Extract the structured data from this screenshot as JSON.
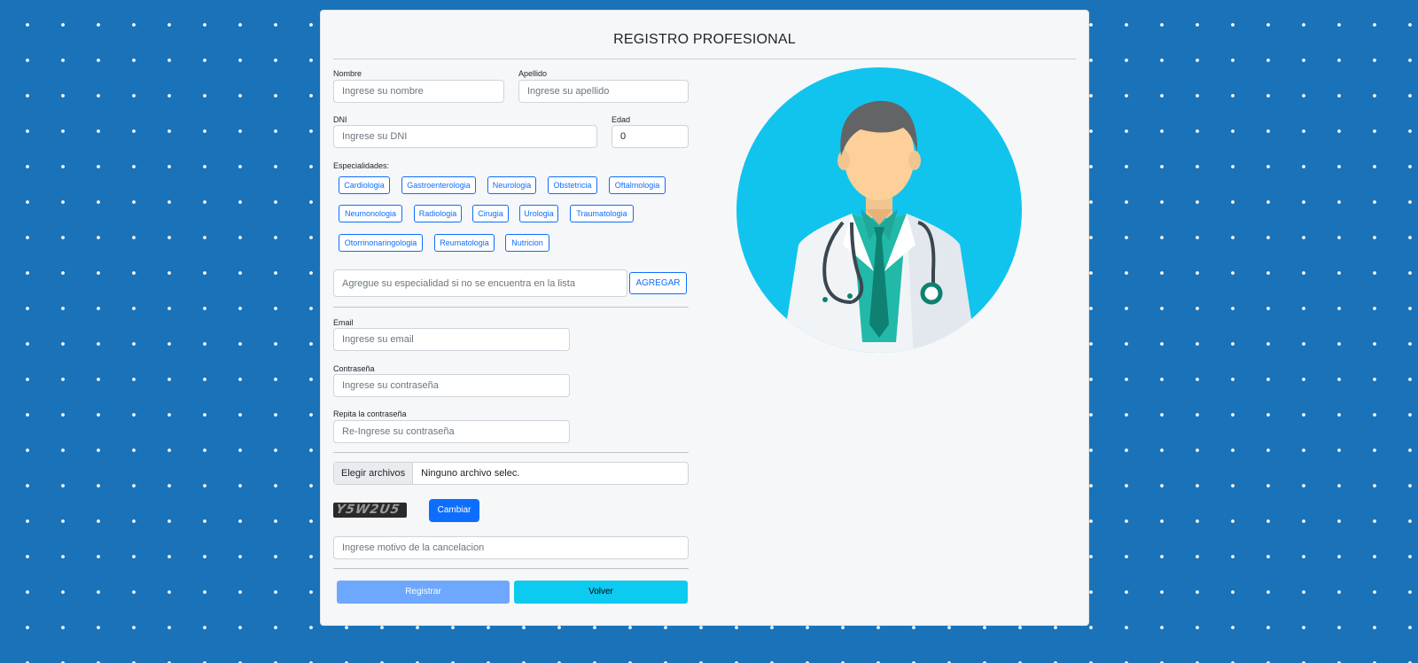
{
  "form": {
    "title": "REGISTRO PROFESIONAL",
    "nombre": {
      "label": "Nombre",
      "placeholder": "Ingrese su nombre"
    },
    "apellido": {
      "label": "Apellido",
      "placeholder": "Ingrese su apellido"
    },
    "dni": {
      "label": "DNI",
      "placeholder": "Ingrese su DNI"
    },
    "edad": {
      "label": "Edad",
      "value": "0"
    },
    "especialidades": {
      "label": "Especialidades:",
      "items": [
        "Cardiologia",
        "Gastroenterologia",
        "Neurologia",
        "Obstetricia",
        "Oftalmologia",
        "Neumonologia",
        "Radiologia",
        "Cirugia",
        "Urologia",
        "Traumatologia",
        "Otorrinonaringologia",
        "Reumatologia",
        "Nutricion"
      ],
      "add_placeholder": "Agregue su especialidad si no se encuentra en la lista",
      "add_button": "AGREGAR"
    },
    "email": {
      "label": "Email",
      "placeholder": "Ingrese su email"
    },
    "password": {
      "label": "Contraseña",
      "placeholder": "Ingrese su contraseña"
    },
    "password_repeat": {
      "label": "Repita la contraseña",
      "placeholder": "Re-Ingrese su contraseña"
    },
    "file": {
      "button": "Elegir archivos",
      "status": "Ninguno archivo selec."
    },
    "captcha": {
      "text": "Y5W2U5",
      "change_button": "Cambiar"
    },
    "captcha_input": {
      "placeholder": "Ingrese motivo de la cancelacion"
    },
    "actions": {
      "register": "Registrar",
      "back": "Volver"
    }
  },
  "colors": {
    "primary": "#0d6efd",
    "register_button": "#6ea8fe",
    "back_button": "#0dcaf0",
    "illustration_circle": "#11c4ee",
    "background_pattern": "#1a73b8"
  },
  "icons": {
    "illustration": "doctor-avatar"
  }
}
